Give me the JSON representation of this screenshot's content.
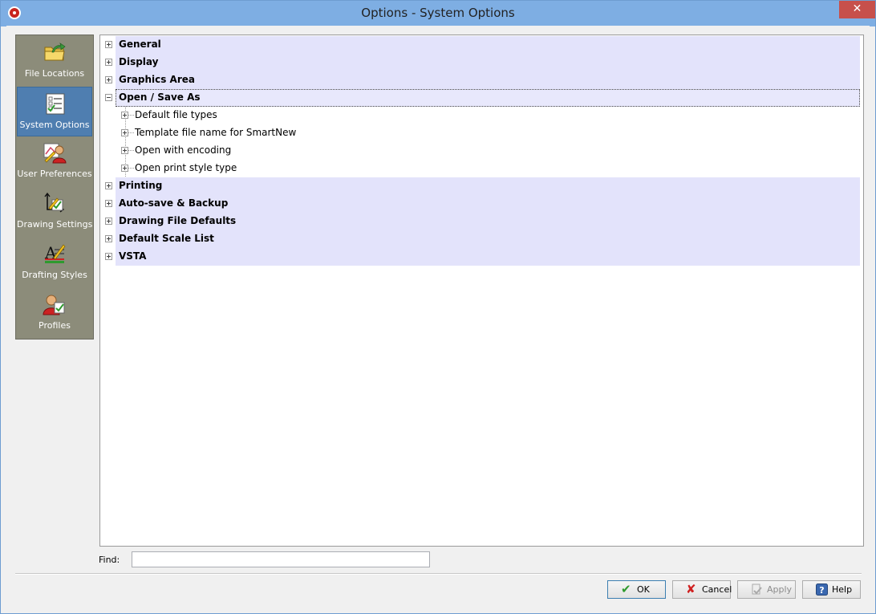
{
  "window": {
    "title": "Options - System Options",
    "close_glyph": "✕"
  },
  "sidebar": {
    "items": [
      {
        "label": "File Locations",
        "icon": "folder-arrow-icon",
        "active": false
      },
      {
        "label": "System Options",
        "icon": "checklist-icon",
        "active": true
      },
      {
        "label": "User Preferences",
        "icon": "user-pencil-icon",
        "active": false
      },
      {
        "label": "Drawing Settings",
        "icon": "drawing-axes-icon",
        "active": false
      },
      {
        "label": "Drafting Styles",
        "icon": "text-style-icon",
        "active": false
      },
      {
        "label": "Profiles",
        "icon": "user-profile-icon",
        "active": false
      }
    ]
  },
  "tree": {
    "items": [
      {
        "label": "General",
        "level": 0,
        "expanded": false
      },
      {
        "label": "Display",
        "level": 0,
        "expanded": false
      },
      {
        "label": "Graphics Area",
        "level": 0,
        "expanded": false
      },
      {
        "label": "Open / Save As",
        "level": 0,
        "expanded": true,
        "selected": true
      },
      {
        "label": "Default file types",
        "level": 1,
        "expanded": false
      },
      {
        "label": "Template file name for SmartNew",
        "level": 1,
        "expanded": false
      },
      {
        "label": "Open with encoding",
        "level": 1,
        "expanded": false
      },
      {
        "label": "Open print style type",
        "level": 1,
        "expanded": false
      },
      {
        "label": "Printing",
        "level": 0,
        "expanded": false
      },
      {
        "label": "Auto-save & Backup",
        "level": 0,
        "expanded": false
      },
      {
        "label": "Drawing File Defaults",
        "level": 0,
        "expanded": false
      },
      {
        "label": "Default Scale List",
        "level": 0,
        "expanded": false
      },
      {
        "label": "VSTA",
        "level": 0,
        "expanded": false
      }
    ]
  },
  "find": {
    "label": "Find:",
    "value": ""
  },
  "buttons": {
    "ok": {
      "label": "OK",
      "icon": "checkmark-icon"
    },
    "cancel": {
      "label": "Cancel",
      "icon": "x-icon"
    },
    "apply": {
      "label": "Apply",
      "icon": "apply-icon",
      "disabled": true
    },
    "help": {
      "label": "Help",
      "icon": "help-icon"
    }
  },
  "colors": {
    "titlebar": "#7eaee3",
    "sidebar": "#8c8c7a",
    "sidebar_active": "#4f7eb0",
    "tree_band": "#e3e3fb",
    "ok_check": "#2e9a2e",
    "cancel_x": "#d02020",
    "help_bg": "#3a68b0"
  }
}
